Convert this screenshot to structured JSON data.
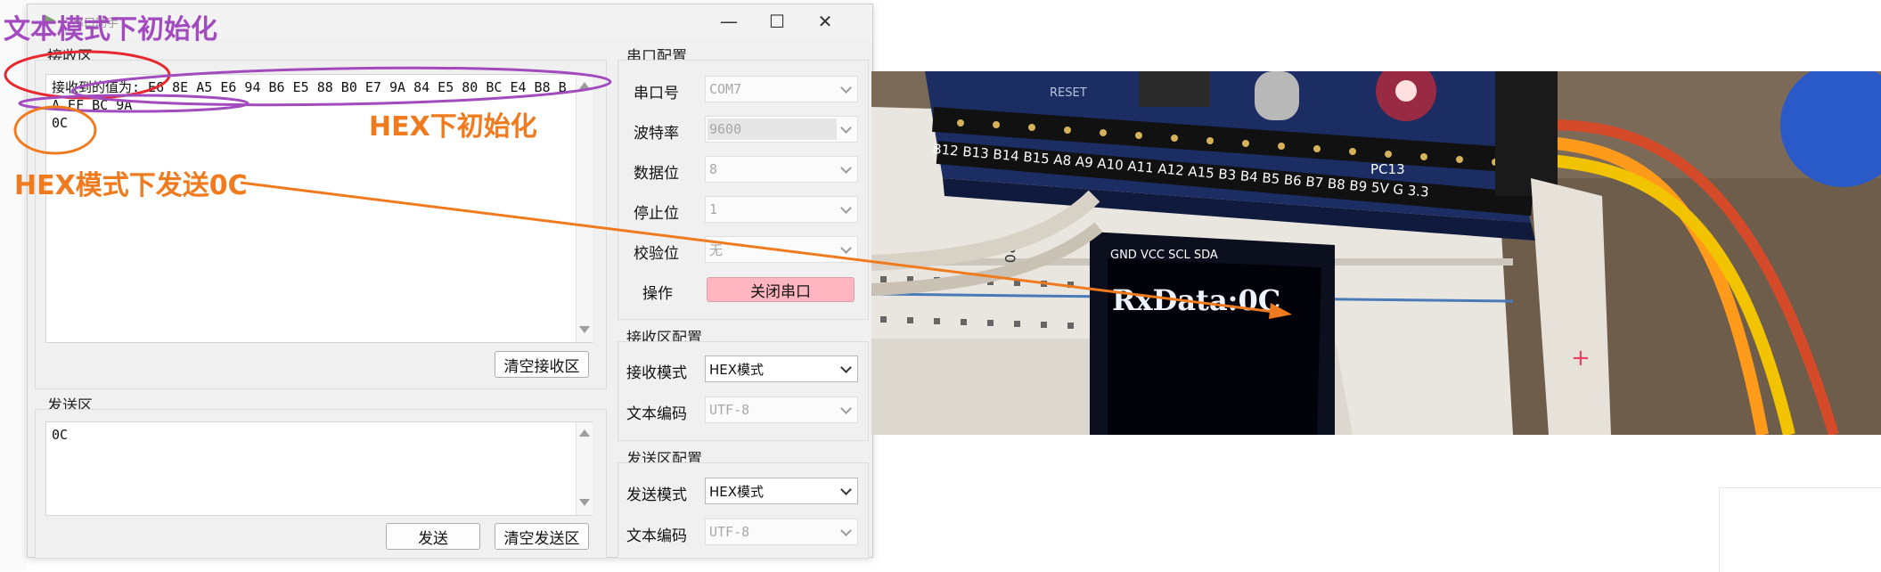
{
  "window": {
    "title": "串口助手",
    "controls": {
      "minimize": "—",
      "maximize": "☐",
      "close": "✕"
    }
  },
  "receive": {
    "group_label": "接收区",
    "text": "接收到的值为: E6 8E A5 E6 94 B6 E5 88 B0 E7 9A 84 E5 80 BC E4 B8 BA EF BC 9A\n0C",
    "clear_button": "清空接收区"
  },
  "send": {
    "group_label": "发送区",
    "text": "0C",
    "send_button": "发送",
    "clear_button": "清空发送区"
  },
  "serial_config": {
    "group_label": "串口配置",
    "fields": [
      {
        "label": "串口号",
        "value": "COM7",
        "enabled": false
      },
      {
        "label": "波特率",
        "value": "9600",
        "enabled": false
      },
      {
        "label": "数据位",
        "value": "8",
        "enabled": false
      },
      {
        "label": "停止位",
        "value": "1",
        "enabled": false
      },
      {
        "label": "校验位",
        "value": "无",
        "enabled": false
      }
    ],
    "operation_label": "操作",
    "operation_button": "关闭串口"
  },
  "receive_config": {
    "group_label": "接收区配置",
    "mode_label": "接收模式",
    "mode_value": "HEX模式",
    "encoding_label": "文本编码",
    "encoding_value": "UTF-8"
  },
  "send_config": {
    "group_label": "发送区配置",
    "mode_label": "发送模式",
    "mode_value": "HEX模式",
    "encoding_label": "文本编码",
    "encoding_value": "UTF-8"
  },
  "annotations": {
    "text_mode_init": "文本模式下初始化",
    "hex_init": "HEX下初始化",
    "hex_send": "HEX模式下发送0C",
    "colors": {
      "purple": "#a24bbf",
      "orange": "#f07a1e",
      "red": "#e8272e"
    }
  },
  "photo": {
    "oled_text": "RxData:0C",
    "board_pins": "B12 B13 B14 B15 A8 A9 A10 A11 A12 A15 B3 B4 B5 B6 B7 B8 B9 5V G 3.3",
    "oled_pins": "GND VCC SCL SDA",
    "pc13_label": "PC13",
    "reset_label": "RESET",
    "row_number": "20"
  },
  "colors": {
    "danger_button": "#ffb6c1",
    "window_bg": "#f0f0f0"
  }
}
